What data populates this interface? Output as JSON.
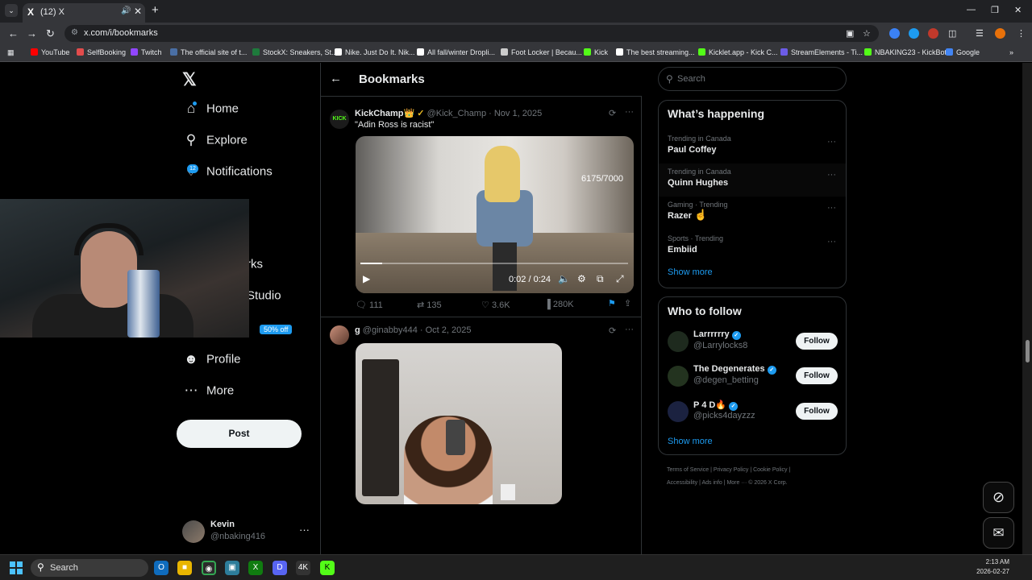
{
  "browser": {
    "tab_title": "(12) X",
    "tab_favicon": "X",
    "url": "x.com/i/bookmarks",
    "bookmarks": [
      {
        "label": "YouTube",
        "color": "#ff0000"
      },
      {
        "label": "SelfBooking",
        "color": "#e34c4c"
      },
      {
        "label": "Twitch",
        "color": "#9146ff"
      },
      {
        "label": "The official site of t...",
        "color": "#4a6fa5"
      },
      {
        "label": "StockX: Sneakers, St...",
        "color": "#1e7a3c"
      },
      {
        "label": "Nike. Just Do It. Nik...",
        "color": "#ffffff"
      },
      {
        "label": "All fall/winter Dropli...",
        "color": "#ffffff"
      },
      {
        "label": "Foot Locker | Becau...",
        "color": "#cccccc"
      },
      {
        "label": "Kick",
        "color": "#53fc18"
      },
      {
        "label": "The best streaming...",
        "color": "#ffffff"
      },
      {
        "label": "Kicklet.app - Kick C...",
        "color": "#53fc18"
      },
      {
        "label": "StreamElements - Ti...",
        "color": "#6c5ce7"
      },
      {
        "label": "NBAKING23 - KickBot",
        "color": "#53fc18"
      },
      {
        "label": "Google",
        "color": "#4285f4"
      }
    ]
  },
  "nav": {
    "home": "Home",
    "explore": "Explore",
    "notifications": "Notifications",
    "notifications_count": "12",
    "bookmarks_partial": "rks",
    "studio_partial": "Studio",
    "premium_badge": "50% off",
    "profile": "Profile",
    "more": "More",
    "post": "Post",
    "account_name": "Kevin",
    "account_handle": "@nbaking416"
  },
  "center": {
    "title": "Bookmarks",
    "tweets": [
      {
        "name": "KickChamp👑",
        "meta": "@Kick_Champ · Nov 1, 2025",
        "text": "\"Adin Ross is racist\"",
        "video_overlay": "6175/7000",
        "video_time": "0:02 / 0:24",
        "video_progress": 0.08,
        "replies": "111",
        "reposts": "135",
        "likes": "3.6K",
        "views": "280K"
      },
      {
        "name": "g",
        "meta": "@ginabby444 · Oct 2, 2025"
      }
    ]
  },
  "right": {
    "search_placeholder": "Search",
    "happening_title": "What’s happening",
    "trends": [
      {
        "context": "Trending in Canada",
        "title": "Paul Coffey"
      },
      {
        "context": "Trending in Canada",
        "title": "Quinn Hughes"
      },
      {
        "context": "Gaming · Trending",
        "title": "Razer"
      },
      {
        "context": "Sports · Trending",
        "title": "Embiid"
      }
    ],
    "show_more": "Show more",
    "wtf_title": "Who to follow",
    "follow_suggestions": [
      {
        "name": "Larrrrrry",
        "handle": "@Larrylocks8",
        "button": "Follow"
      },
      {
        "name": "The Degenerates",
        "handle": "@degen_betting",
        "button": "Follow"
      },
      {
        "name": "P 4 D🔥",
        "handle": "@picks4dayzzz",
        "button": "Follow"
      }
    ],
    "footer_line1": "Terms of Service  |  Privacy Policy  |  Cookie Policy  |",
    "footer_line2": "Accessibility  |  Ads info  |  More ···  © 2026 X Corp."
  },
  "taskbar": {
    "search": "Search",
    "time": "2:13 AM",
    "date": "2026-02-27"
  }
}
